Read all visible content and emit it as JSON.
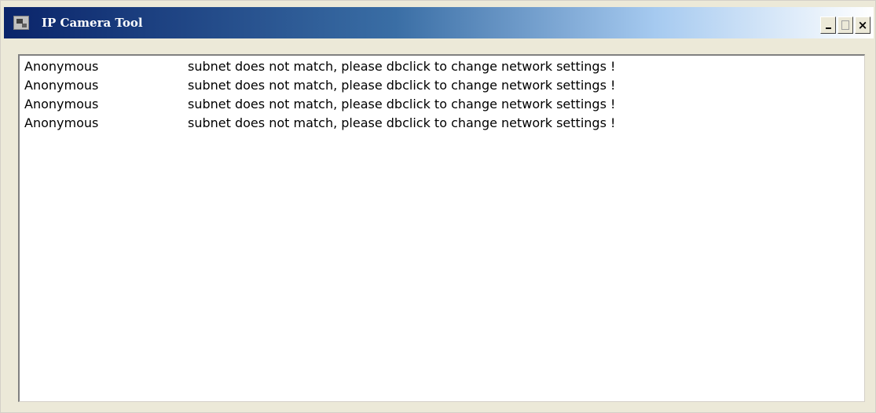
{
  "window": {
    "title": "IP Camera Tool",
    "controls": {
      "minimize": "-",
      "maximize": "□",
      "close": "×"
    }
  },
  "devices": [
    {
      "name": "Anonymous",
      "status": "subnet does not match, please dbclick to change network settings !"
    },
    {
      "name": "Anonymous",
      "status": "subnet does not match, please dbclick to change network settings !"
    },
    {
      "name": "Anonymous",
      "status": "subnet does not match, please dbclick to change network settings !"
    },
    {
      "name": "Anonymous",
      "status": "subnet does not match, please dbclick to change network settings !"
    }
  ],
  "colors": {
    "titlebar_start": "#0a246a",
    "titlebar_end": "#ffffff",
    "window_bg": "#ece9d8",
    "list_bg": "#ffffff"
  }
}
